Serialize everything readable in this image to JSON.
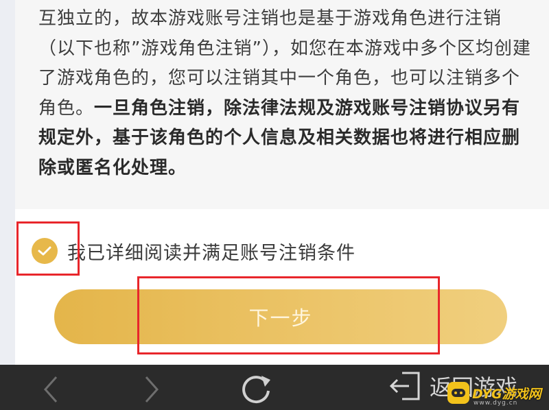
{
  "content": {
    "paragraph_normal": "互独立的，故本游戏账号注销也是基于游戏角色进行注销（以下也称”游戏角色注销”），如您在本游戏中多个区均创建了游戏角色的，您可以注销其中一个角色，也可以注销多个角色。",
    "paragraph_bold": "一旦角色注销，除法律法规及游戏账号注销协议另有规定外，基于该角色的个人信息及相关数据也将进行相应删除或匿名化处理。"
  },
  "agreement": {
    "checked": true,
    "label": "我已详细阅读并满足账号注销条件"
  },
  "next_button": {
    "label": "下一步"
  },
  "bottom_bar": {
    "back_game_label": "返回游戏",
    "icons": [
      "chevron-left-icon",
      "chevron-right-icon",
      "refresh-icon",
      "exit-icon"
    ]
  },
  "watermark": {
    "text": "DYG游戏网",
    "sub": "www.dyg.cn"
  },
  "colors": {
    "accent": "#e7b84a",
    "highlight_box": "#e8262b",
    "bottom_bar": "#2b2b2b"
  }
}
